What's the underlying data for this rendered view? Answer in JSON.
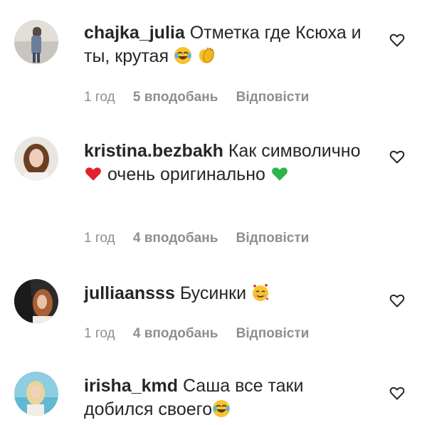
{
  "comments": [
    {
      "username": "chajka_julia",
      "text": "Отметка где Ксюха и ты, крутая",
      "emojis": [
        "joy-emoji",
        "clapping-hands-emoji"
      ],
      "time": "1 год",
      "likes": "5 вподобань",
      "reply": "Відповісти"
    },
    {
      "username": "kristina.bezbakh",
      "text_part1": "Как символично",
      "text_part2": "очень оригинально",
      "emojis": [
        "red-heart-emoji",
        "green-heart-emoji"
      ],
      "time": "1 год",
      "likes": "4 вподобань",
      "reply": "Відповісти"
    },
    {
      "username": "julliaansss",
      "text": "Бусинки",
      "emojis": [
        "smiling-face-with-hearts-emoji"
      ],
      "time": "1 год",
      "likes": "4 вподобань",
      "reply": "Відповісти"
    },
    {
      "username": "irisha_kmd",
      "text": "Саша все таки добился своего",
      "emojis": [
        "joy-emoji"
      ],
      "time": "",
      "likes": "",
      "reply": ""
    }
  ],
  "colors": {
    "text": "#262626",
    "meta": "#8e8e8e",
    "red_heart": "#e0232e",
    "green_heart": "#2db34a",
    "emoji_yellow": "#f7c32e"
  },
  "icons": {
    "like": "heart-outline-icon"
  }
}
